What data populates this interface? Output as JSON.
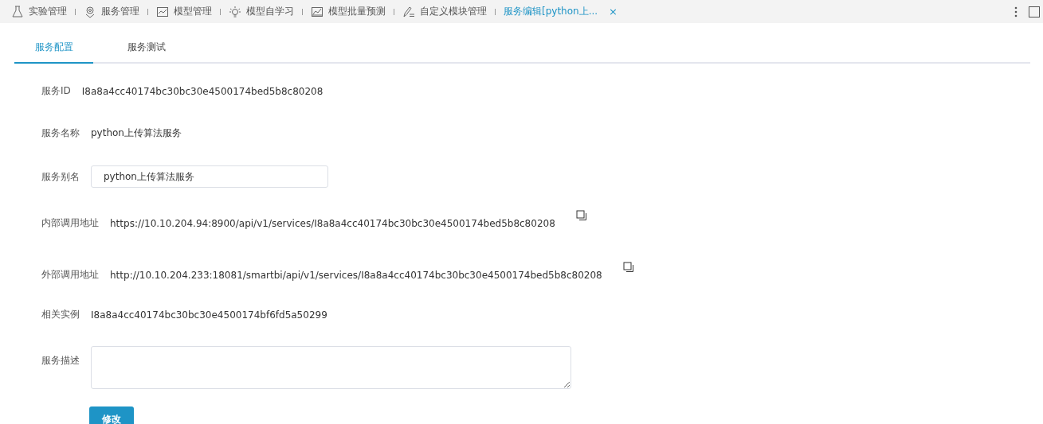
{
  "top_tabs": [
    {
      "label": "实验管理",
      "selected": false
    },
    {
      "label": "服务管理",
      "selected": false
    },
    {
      "label": "模型管理",
      "selected": false
    },
    {
      "label": "模型自学习",
      "selected": false
    },
    {
      "label": "模型批量预测",
      "selected": false
    },
    {
      "label": "自定义模块管理",
      "selected": false
    },
    {
      "label": "服务编辑[python上...",
      "selected": true,
      "close_label": "×"
    }
  ],
  "sub_tabs": [
    {
      "label": "服务配置",
      "selected": true
    },
    {
      "label": "服务测试",
      "selected": false
    }
  ],
  "fields": [
    {
      "kind": "text",
      "label": "服务ID",
      "value": "I8a8a4cc40174bc30bc30e4500174bed5b8c80208"
    },
    {
      "kind": "text",
      "label": "服务名称",
      "value": "python上传算法服务"
    },
    {
      "kind": "input",
      "label": "服务别名",
      "value": "python上传算法服务"
    },
    {
      "kind": "copy",
      "label": "内部调用地址",
      "value": "https://10.10.204.94:8900/api/v1/services/I8a8a4cc40174bc30bc30e4500174bed5b8c80208"
    },
    {
      "kind": "copy",
      "label": "外部调用地址",
      "value": "http://10.10.204.233:18081/smartbi/api/v1/services/I8a8a4cc40174bc30bc30e4500174bed5b8c80208"
    },
    {
      "kind": "text",
      "label": "相关实例",
      "value": "I8a8a4cc40174bc30bc30e4500174bf6fd5a50299"
    },
    {
      "kind": "textarea",
      "label": "服务描述"
    }
  ],
  "submit_button": "修改"
}
